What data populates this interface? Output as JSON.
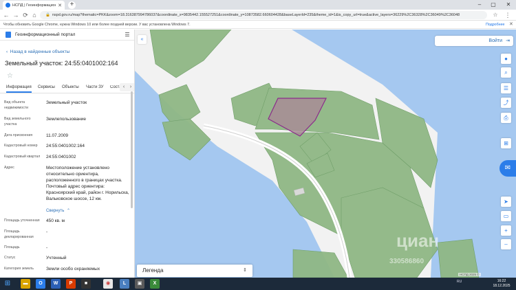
{
  "browser": {
    "tab_title": "НСПД | Геоинформационный ...",
    "url": "nspd.gov.ru/map?thematic=PKK&zoom=18.316387994786037&coordinate_x=9835442.155527251&coordinate_y=10873582.660604428&baseLayerId=235&theme_id=1&is_copy_url=true&active_layers=36229%2C36328%2C36049%2C36048",
    "infobar_text": "Чтобы обновить Google Chrome, нужна Windows 10 или более поздней версии. У вас установлена Windows 7.",
    "infobar_link": "Подробнее"
  },
  "panel": {
    "portal_title": "Геоинформационный портал",
    "back_link": "Назад в найденные объекты",
    "parcel_title": "Земельный участок: 24:55:0401002:164",
    "tabs": [
      {
        "label": "Информация",
        "active": true
      },
      {
        "label": "Сервисы"
      },
      {
        "label": "Объекты"
      },
      {
        "label": "Части ЗУ"
      },
      {
        "label": "Состав"
      }
    ],
    "fields": [
      {
        "label": "Вид объекта недвижимости",
        "value": "Земельный участок"
      },
      {
        "label": "Вид земельного участка",
        "value": "Землепользование"
      },
      {
        "label": "Дата присвоения",
        "value": "11.07.2009"
      },
      {
        "label": "Кадастровый номер",
        "value": "24:55:0401002:164"
      },
      {
        "label": "Кадастровый квартал",
        "value": "24:55:0401002"
      },
      {
        "label": "Адрес",
        "value": "Местоположение установлено относительно ориентира, расположенного в границах участка. Почтовый адрес ориентира: Красноярский край, район г. Норильска, Вальковское шоссе, 12 км."
      },
      {
        "label": "Площадь уточненная",
        "value": "450 кв. м"
      },
      {
        "label": "Площадь декларированная",
        "value": "-"
      },
      {
        "label": "Площадь",
        "value": "-"
      },
      {
        "label": "Статус",
        "value": "Учтенный"
      },
      {
        "label": "Категория земель",
        "value": "Земли особо охраняемых"
      }
    ],
    "collapse_label": "Свернуть"
  },
  "map": {
    "login_label": "Войти",
    "legend_label": "Легенда",
    "watermark": "циан",
    "watermark_id": "330586860",
    "attribution": "НСПД 2025 ©",
    "colors": {
      "water": "#a5c8f0",
      "land": "#f2f2f2",
      "parcel": "#8fb885",
      "selected": "#a88c95",
      "selected_stroke": "#8a2c8a"
    }
  },
  "taskbar": {
    "lang": "RU",
    "time": "16:22",
    "date": "18.12.2025"
  }
}
